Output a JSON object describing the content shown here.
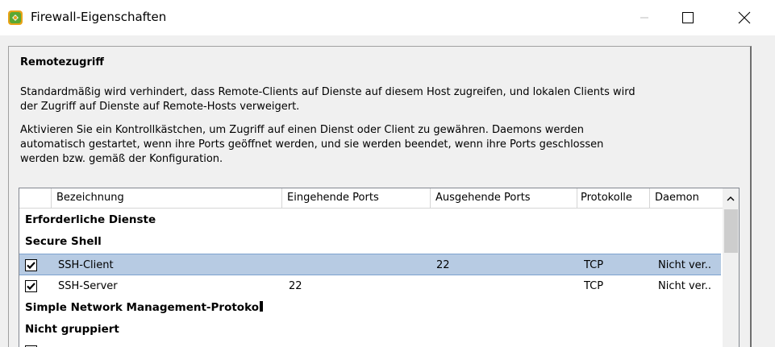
{
  "window": {
    "title": "Firewall-Eigenschaften",
    "icon": "vsphere-client-icon",
    "controls": {
      "minimize": "minimize-icon",
      "maximize": "maximize-icon",
      "close": "close-icon"
    }
  },
  "section": {
    "title": "Remotezugriff",
    "paragraph1": [
      "Standardmäßig wird verhindert, dass Remote-Clients auf Dienste auf diesem Host zugreifen, und lokalen Clients wird",
      "der Zugriff auf Dienste auf Remote-Hosts verweigert."
    ],
    "paragraph2": [
      "Aktivieren Sie ein Kontrollkästchen, um Zugriff auf einen Dienst oder Client zu gewähren. Daemons werden",
      "automatisch gestartet, wenn ihre Ports geöffnet werden, und sie werden beendet, wenn ihre Ports geschlossen",
      "werden bzw. gemäß der Konfiguration."
    ]
  },
  "table": {
    "columns": [
      "",
      "Bezeichnung",
      "Eingehende Ports",
      "Ausgehende Ports",
      "Protokolle",
      "Daemon"
    ],
    "rows": [
      {
        "type": "group",
        "label": "Erforderliche Dienste"
      },
      {
        "type": "group",
        "label": "Secure Shell"
      },
      {
        "type": "item",
        "checked": true,
        "selected": true,
        "name": "SSH-Client",
        "in": "",
        "out": "22",
        "proto": "TCP",
        "daemon": "Nicht ver.."
      },
      {
        "type": "item",
        "checked": true,
        "selected": false,
        "name": "SSH-Server",
        "in": "22",
        "out": "",
        "proto": "TCP",
        "daemon": "Nicht ver.."
      },
      {
        "type": "group",
        "label": "Simple Network Management-Protoko"
      },
      {
        "type": "group",
        "label": "Nicht gruppiert"
      }
    ]
  },
  "colors": {
    "selected_row": "#b7cbe3",
    "selected_border": "#7da2ce",
    "dialog_bg": "#f0f0f0",
    "icon_green": "#5aa832",
    "icon_orange": "#e8a317"
  }
}
